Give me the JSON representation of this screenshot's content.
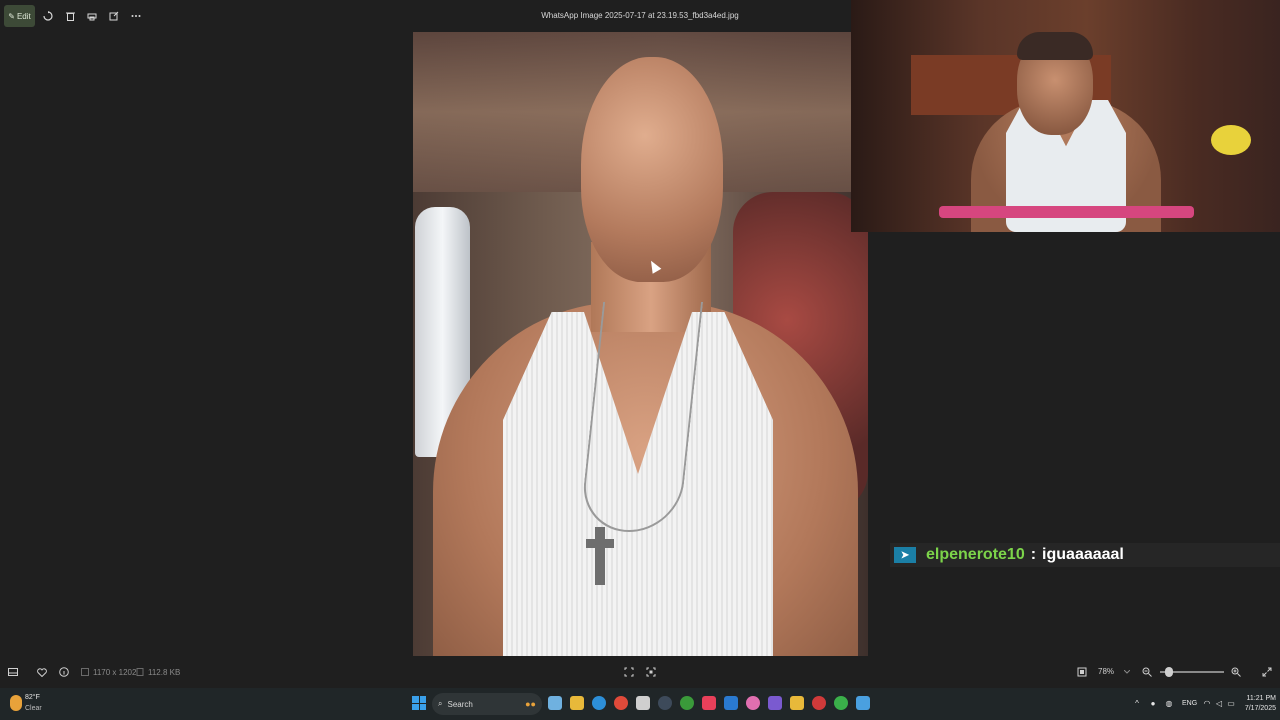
{
  "viewer": {
    "toolbar": {
      "edit_label": "Edit",
      "file_name": "WhatsApp Image 2025-07-17 at 23.19.53_fbd3a4ed.jpg"
    },
    "status": {
      "dimensions": "1170 x 1202",
      "file_size": "112.8 KB",
      "zoom": "78%"
    }
  },
  "chat": {
    "username": "elpenerote10",
    "separator": ":",
    "message": "iguaaaaaal"
  },
  "taskbar": {
    "weather_temp": "82°F",
    "weather_condition": "Clear",
    "search_placeholder": "Search",
    "language": "ENG",
    "time": "11:21 PM",
    "date": "7/17/2025"
  },
  "colors": {
    "chat_username": "#7cd44a",
    "edit_active": "#3d4a37",
    "windows_accent": "#3aa0ea"
  }
}
